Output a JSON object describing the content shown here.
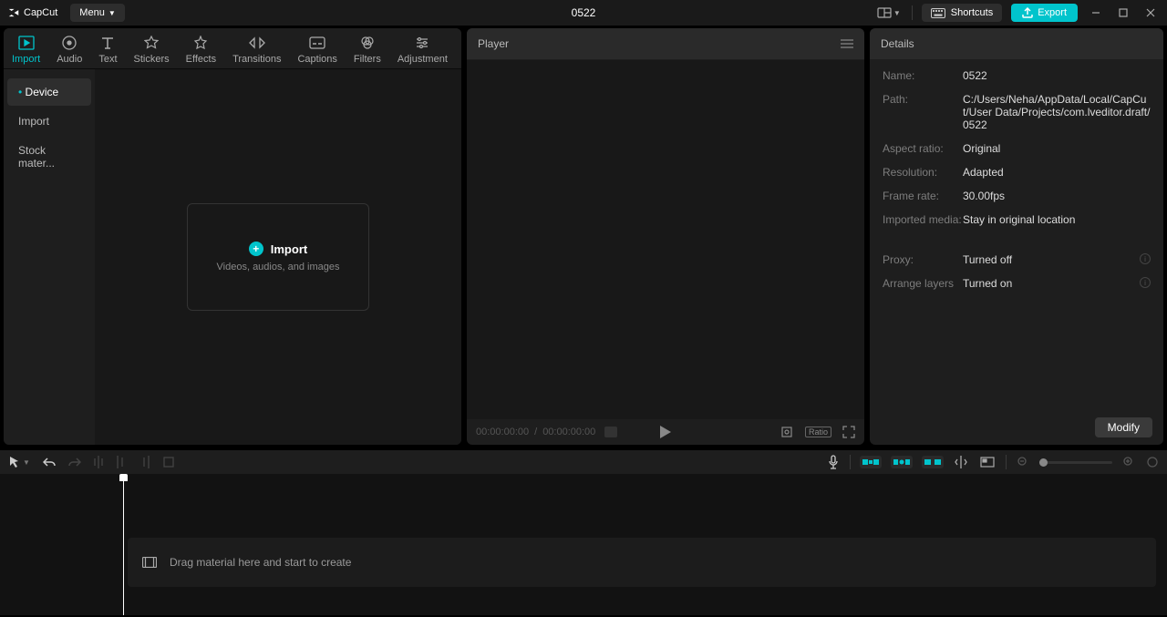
{
  "app": {
    "name": "CapCut",
    "menu": "Menu",
    "project_title": "0522"
  },
  "topbar": {
    "shortcuts": "Shortcuts",
    "export": "Export"
  },
  "media_tabs": [
    {
      "label": "Import",
      "active": true
    },
    {
      "label": "Audio"
    },
    {
      "label": "Text"
    },
    {
      "label": "Stickers"
    },
    {
      "label": "Effects"
    },
    {
      "label": "Transitions"
    },
    {
      "label": "Captions"
    },
    {
      "label": "Filters"
    },
    {
      "label": "Adjustment"
    }
  ],
  "media_side": {
    "device": "Device",
    "import": "Import",
    "stock": "Stock mater..."
  },
  "import_box": {
    "title": "Import",
    "subtitle": "Videos, audios, and images"
  },
  "player": {
    "title": "Player",
    "time_current": "00:00:00:00",
    "time_total": "00:00:00:00",
    "ratio": "Ratio"
  },
  "details": {
    "title": "Details",
    "rows": {
      "name_label": "Name:",
      "name": "0522",
      "path_label": "Path:",
      "path": "C:/Users/Neha/AppData/Local/CapCut/User Data/Projects/com.lveditor.draft/0522",
      "aspect_label": "Aspect ratio:",
      "aspect": "Original",
      "res_label": "Resolution:",
      "res": "Adapted",
      "fps_label": "Frame rate:",
      "fps": "30.00fps",
      "im_label": "Imported media:",
      "im": "Stay in original location",
      "proxy_label": "Proxy:",
      "proxy": "Turned off",
      "layers_label": "Arrange layers",
      "layers": "Turned on"
    },
    "modify": "Modify"
  },
  "timeline": {
    "placeholder": "Drag material here and start to create"
  }
}
